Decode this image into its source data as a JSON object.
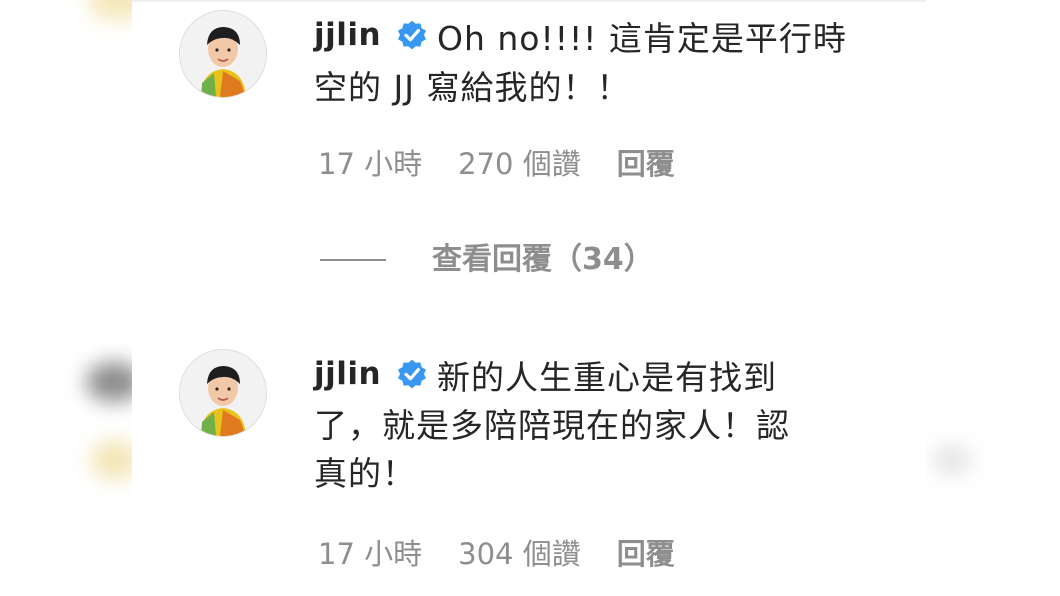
{
  "comments": [
    {
      "username": "jjlin",
      "verified_icon": "verified-badge-icon",
      "text_line1": "Oh no!!!! 這肯定是平行時",
      "text_line2": "空的 JJ 寫給我的！！",
      "time": "17 小時",
      "likes": "270 個讚",
      "reply_label": "回覆"
    },
    {
      "username": "jjlin",
      "verified_icon": "verified-badge-icon",
      "text_line1": "新的人生重心是有找到",
      "text_line2": "了，就是多陪陪現在的家人！認",
      "text_line3": "真的！",
      "time": "17 小時",
      "likes": "304 個讚",
      "reply_label": "回覆"
    }
  ],
  "view_replies": {
    "label": "查看回覆（34）"
  },
  "colors": {
    "text_primary": "#262626",
    "text_secondary": "#8e8e8e",
    "verified_blue": "#3897f0"
  }
}
